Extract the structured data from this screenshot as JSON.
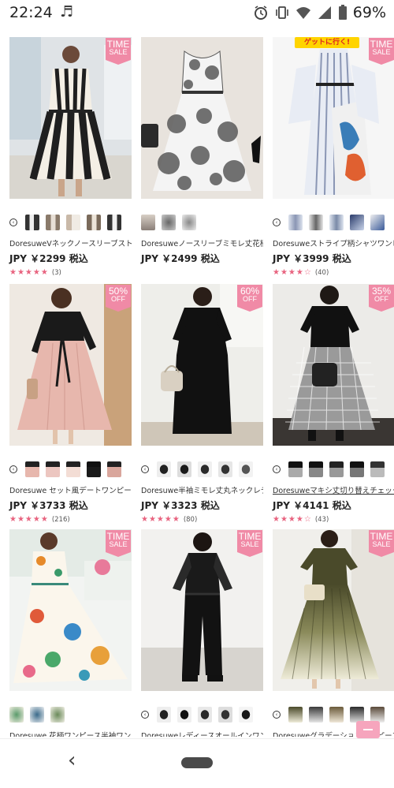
{
  "status_bar": {
    "time": "22:24",
    "music_icon": "music-note-icon",
    "battery_percent": "69%"
  },
  "promo_banner": "ゲットに行く!",
  "products": [
    {
      "title": "DoresuweVネックノースリーブストライプ",
      "price": "JPY ￥2299 税込",
      "stars": 5,
      "reviews": "(3)",
      "badge": [
        "TIME",
        "SALE"
      ],
      "thumb_count": 5,
      "has_chevron": true,
      "underline": false
    },
    {
      "title": "Doresuweノースリーブミモレ丈花柄ワン",
      "price": "JPY ￥2499 税込",
      "stars": 0,
      "reviews": "",
      "badge": null,
      "thumb_count": 3,
      "has_chevron": false,
      "underline": false
    },
    {
      "title": "Doresuweストライプ柄シャツワンピース",
      "price": "JPY ￥3999 税込",
      "stars": 4,
      "reviews": "(40)",
      "badge": [
        "TIME",
        "SALE"
      ],
      "thumb_count": 5,
      "has_chevron": true,
      "underline": false
    },
    {
      "title": "Doresuwe セット風デートワンピースレデ",
      "price": "JPY ￥3733 税込",
      "stars": 5,
      "reviews": "(216)",
      "badge": [
        "50%",
        "OFF"
      ],
      "thumb_count": 5,
      "has_chevron": true,
      "underline": false
    },
    {
      "title": "Doresuwe半袖ミモレ丈丸ネックレディー",
      "price": "JPY ￥3323 税込",
      "stars": 5,
      "reviews": "(80)",
      "badge": [
        "60%",
        "OFF"
      ],
      "thumb_count": 5,
      "has_chevron": true,
      "underline": false
    },
    {
      "title": "Doresuweマキシ丈切り替えチェック柄ワ",
      "price": "JPY ￥4141 税込",
      "stars": 4,
      "reviews": "(43)",
      "badge": [
        "35%",
        "OFF"
      ],
      "thumb_count": 5,
      "has_chevron": true,
      "underline": true
    },
    {
      "title": "Doresuwe 花柄ワンピース半袖ワンピース",
      "price": "",
      "stars": 0,
      "reviews": "",
      "badge": [
        "TIME",
        "SALE"
      ],
      "thumb_count": 3,
      "has_chevron": false,
      "underline": false
    },
    {
      "title": "Doresuweレディースオールインワン Vネ",
      "price": "",
      "stars": 0,
      "reviews": "",
      "badge": [
        "TIME",
        "SALE"
      ],
      "thumb_count": 5,
      "has_chevron": true,
      "underline": false
    },
    {
      "title": "Doresuweグラデーションワンピースプリ",
      "price": "",
      "stars": 0,
      "reviews": "",
      "badge": [
        "TIME",
        "SALE"
      ],
      "thumb_count": 5,
      "has_chevron": true,
      "underline": false
    }
  ],
  "colors": {
    "accent_pink": "#f08aa6",
    "star_pink": "#e8637f"
  }
}
